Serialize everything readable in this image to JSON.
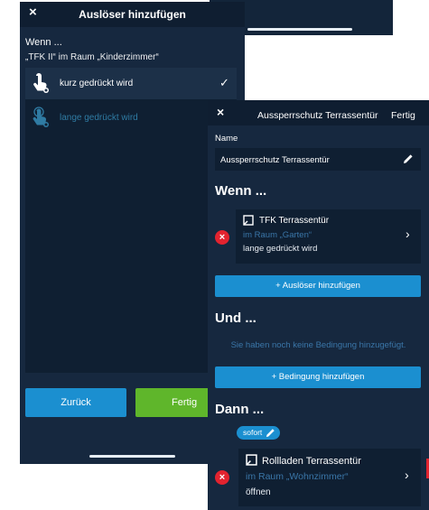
{
  "left_screen": {
    "title": "Auslöser hinzufügen",
    "close_icon": "×",
    "wenn_heading": "Wenn ...",
    "context": "„TFK II“ im Raum „Kinderzimmer“",
    "options": [
      {
        "label": "kurz gedrückt wird",
        "selected": true,
        "icon": "tap-icon"
      },
      {
        "label": "lange gedrückt wird",
        "selected": false,
        "icon": "long-press-icon"
      }
    ],
    "checkmark": "✓",
    "back_label": "Zurück",
    "done_label": "Fertig"
  },
  "right_screen": {
    "close_icon": "×",
    "title": "Aussperrschutz Terrassentür",
    "done_label": "Fertig",
    "name_label": "Name",
    "name_value": "Aussperrschutz Terrassentür",
    "wenn_heading": "Wenn ...",
    "trigger": {
      "device": "TFK Terrassentür",
      "room": "im Raum „Garten“",
      "state": "lange gedrückt wird"
    },
    "add_trigger_label": "+ Auslöser hinzufügen",
    "und_heading": "Und ...",
    "no_condition_text": "Sie haben noch keine Bedingung hinzugefügt.",
    "add_condition_label": "+ Bedingung hinzufügen",
    "dann_heading": "Dann ...",
    "timing_badge": "sofort",
    "action": {
      "device": "Rollladen Terrassentür",
      "room": "im Raum „Wohnzimmer“",
      "state": "öffnen"
    },
    "chevron": "›",
    "remove_icon": "×"
  },
  "colors": {
    "background": "#16283f",
    "header": "#0f1e31",
    "panel": "#0f1f32",
    "accent_blue": "#1b8fd0",
    "accent_green": "#5fb62b",
    "room_text": "#3a76a8",
    "remove_red": "#e2232f"
  }
}
